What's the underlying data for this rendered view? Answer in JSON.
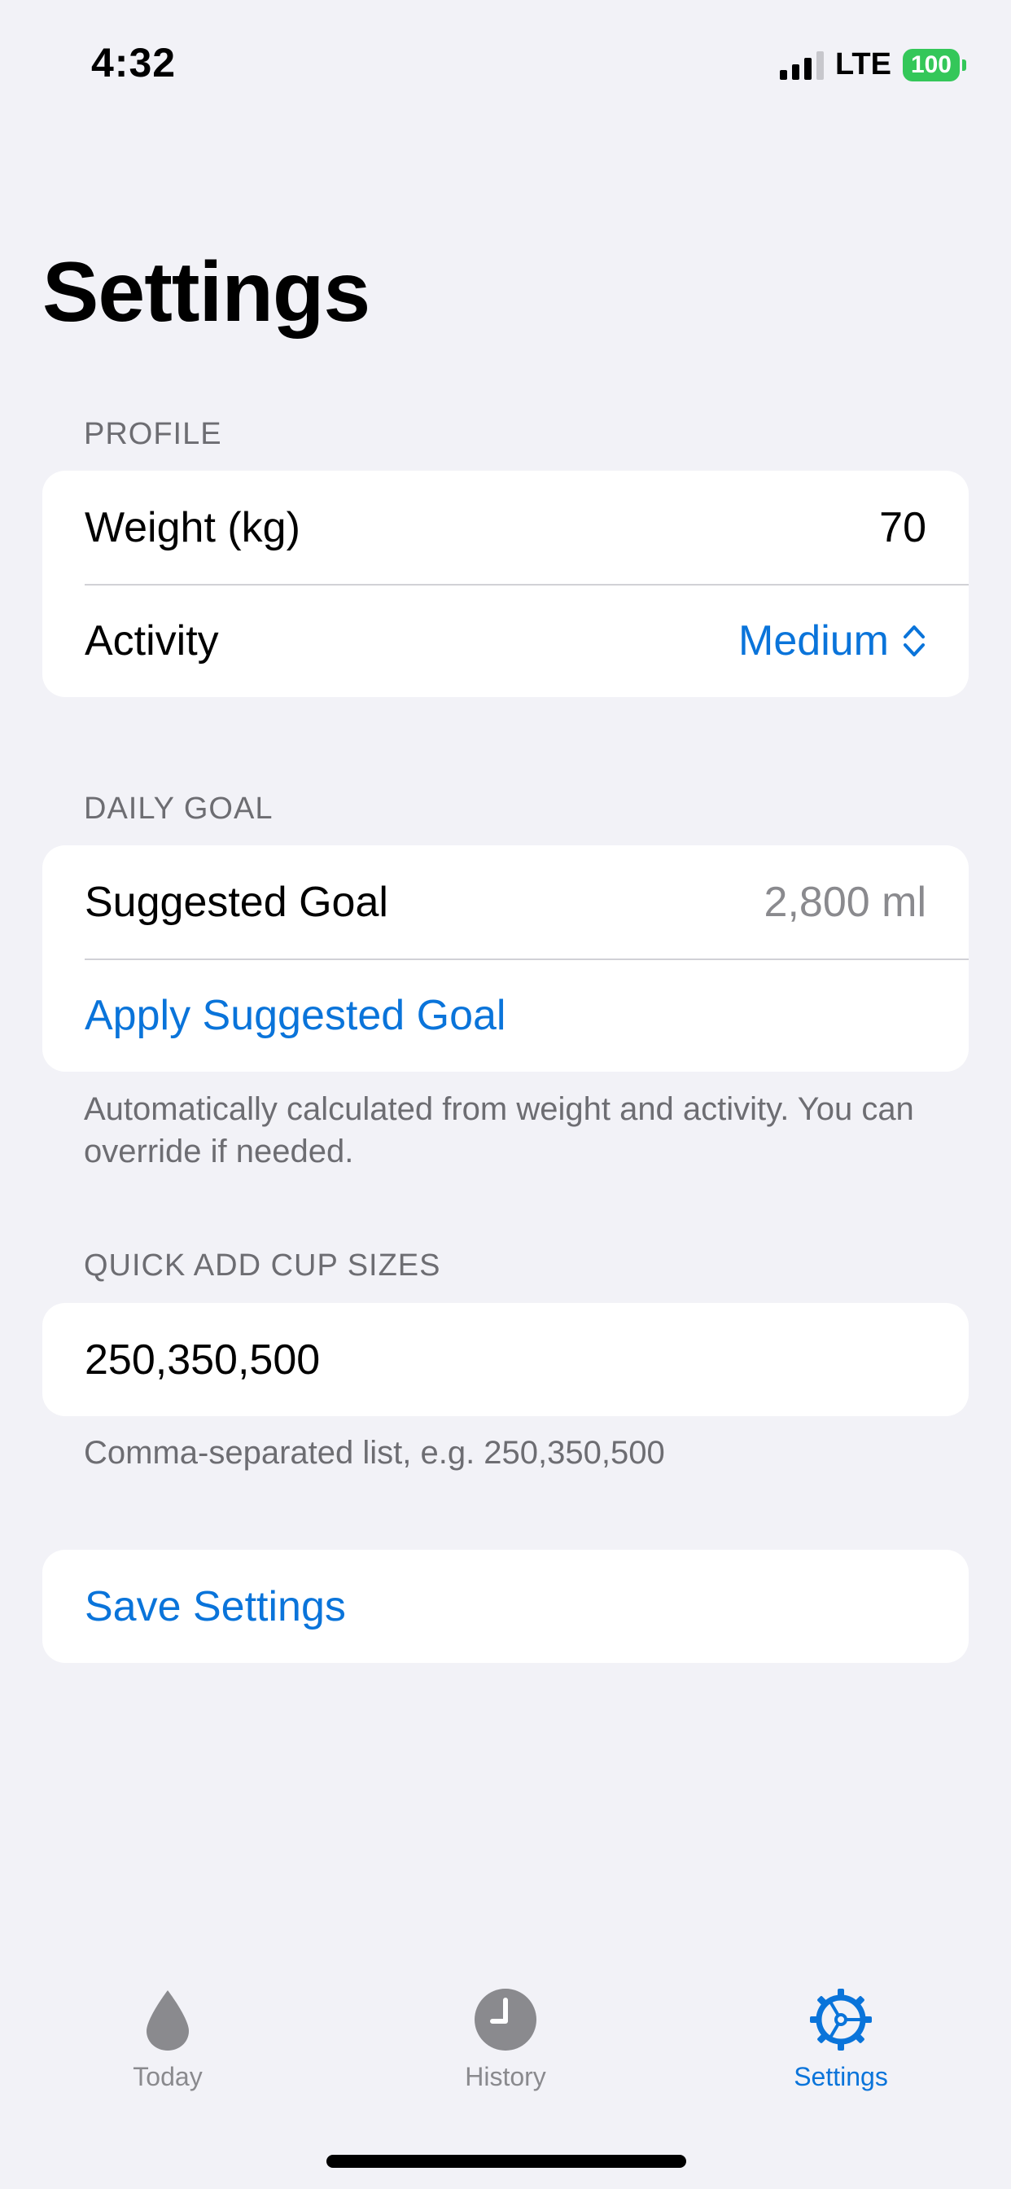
{
  "status_bar": {
    "time": "4:32",
    "network": "LTE",
    "battery": "100",
    "colors": {
      "battery": "#34c759"
    }
  },
  "page": {
    "title": "Settings"
  },
  "profile": {
    "header": "PROFILE",
    "weight_label": "Weight (kg)",
    "weight_value": "70",
    "activity_label": "Activity",
    "activity_value": "Medium"
  },
  "daily_goal": {
    "header": "DAILY GOAL",
    "suggested_label": "Suggested Goal",
    "suggested_value": "2,800 ml",
    "apply_label": "Apply Suggested Goal",
    "footer": "Automatically calculated from weight and activity. You can override if needed."
  },
  "cup_sizes": {
    "header": "QUICK ADD CUP SIZES",
    "value": "250,350,500",
    "footer": "Comma-separated list, e.g. 250,350,500"
  },
  "actions": {
    "save_label": "Save Settings"
  },
  "tab_bar": {
    "tabs": [
      {
        "label": "Today",
        "icon": "water-drop-icon"
      },
      {
        "label": "History",
        "icon": "clock-icon"
      },
      {
        "label": "Settings",
        "icon": "gear-icon"
      }
    ],
    "active": "Settings"
  },
  "colors": {
    "accent": "#0a74da",
    "background": "#f2f2f7",
    "inactive": "#8a8a8e"
  }
}
